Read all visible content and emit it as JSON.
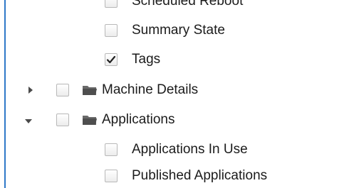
{
  "tree": {
    "items": [
      {
        "label": "Scheduled Reboot",
        "checked": false
      },
      {
        "label": "Summary State",
        "checked": false
      },
      {
        "label": "Tags",
        "checked": true
      },
      {
        "label": "Machine Details",
        "checked": false,
        "folder": true,
        "expanded": false
      },
      {
        "label": "Applications",
        "checked": false,
        "folder": true,
        "expanded": true
      },
      {
        "label": "Applications In Use",
        "checked": false
      },
      {
        "label": "Published Applications",
        "checked": false
      }
    ]
  },
  "colors": {
    "accent_rule": "#2f78c8",
    "folder": "#555555",
    "text": "#1b1b1b"
  },
  "icons": {
    "collapsed": "caret-right-icon",
    "expanded": "caret-down-icon",
    "folder": "folder-icon",
    "check": "checkmark-icon"
  }
}
